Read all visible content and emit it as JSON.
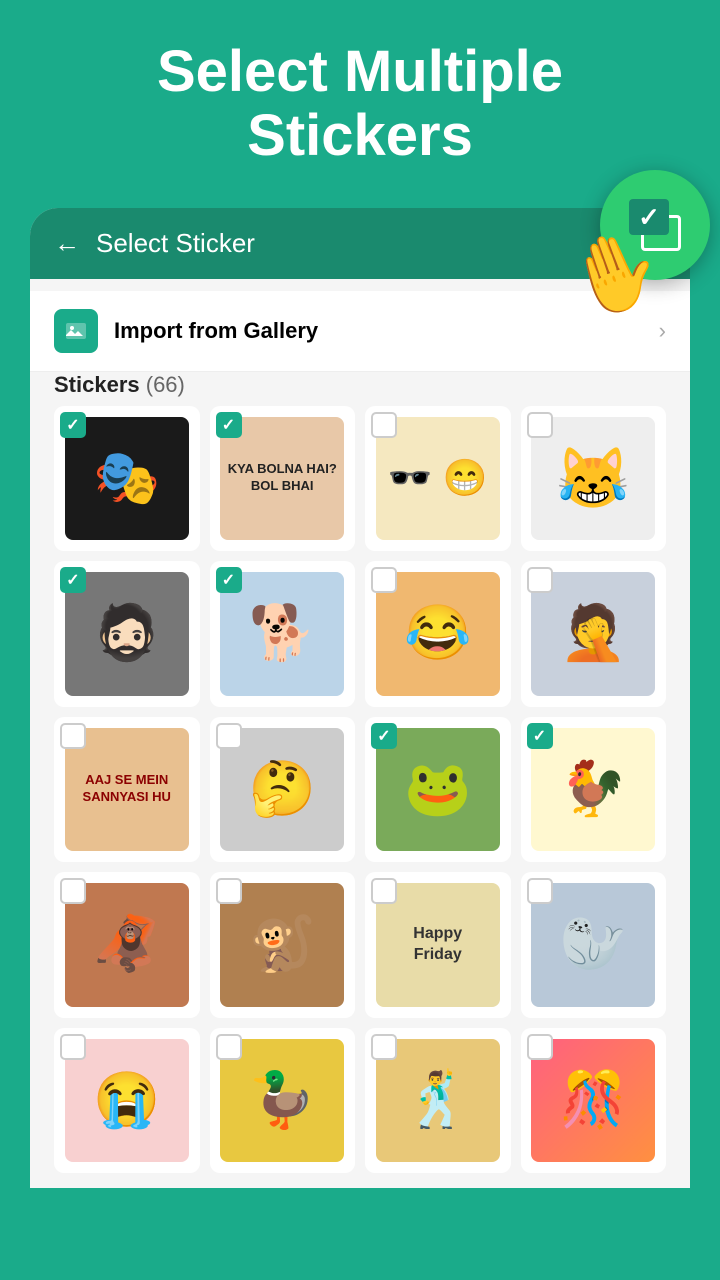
{
  "header": {
    "line1": "Select Multiple",
    "line2": "Stickers"
  },
  "topbar": {
    "title": "Select Sticker",
    "back_label": "←"
  },
  "import": {
    "label": "Import from Gallery",
    "chevron": "›"
  },
  "stickers_section": {
    "label": "Stickers",
    "count": "(66)"
  },
  "fab": {
    "label": "multi-select"
  },
  "stickers": [
    {
      "id": 1,
      "checked": true,
      "emoji": "🎭",
      "bg": "#1a1a1a"
    },
    {
      "id": 2,
      "checked": true,
      "text": "KYA BOLNA HAI? BOL BHAI",
      "bg": "#e8d5c4"
    },
    {
      "id": 3,
      "checked": false,
      "emoji": "🕶️😁",
      "bg": "#f9e4b7"
    },
    {
      "id": 4,
      "checked": false,
      "emoji": "😹",
      "bg": "#eee"
    },
    {
      "id": 5,
      "checked": true,
      "emoji": "🧔",
      "bg": "#555"
    },
    {
      "id": 6,
      "checked": true,
      "emoji": "🐕",
      "bg": "#c9d8e8"
    },
    {
      "id": 7,
      "checked": false,
      "emoji": "😂",
      "bg": "#f0c070"
    },
    {
      "id": 8,
      "checked": false,
      "emoji": "🤦",
      "bg": "#d0d8e0"
    },
    {
      "id": 9,
      "checked": false,
      "text": "AAJ SE MEIN SANNYASI HU",
      "bg": "#e8c4a0"
    },
    {
      "id": 10,
      "checked": false,
      "emoji": "🤔",
      "bg": "#d0d0d0"
    },
    {
      "id": 11,
      "checked": true,
      "emoji": "🐸",
      "bg": "#6aaa4a"
    },
    {
      "id": 12,
      "checked": true,
      "emoji": "🐓",
      "bg": "#fff8e0"
    },
    {
      "id": 13,
      "checked": false,
      "emoji": "🦧",
      "bg": "#c8845a"
    },
    {
      "id": 14,
      "checked": false,
      "emoji": "🐒",
      "bg": "#c09060"
    },
    {
      "id": 15,
      "checked": false,
      "text": "Happy Friday",
      "bg": "#f0e8c8"
    },
    {
      "id": 16,
      "checked": false,
      "emoji": "🦭",
      "bg": "#c8d8e8"
    },
    {
      "id": 17,
      "checked": false,
      "emoji": "😭",
      "bg": "#f8d8d8"
    },
    {
      "id": 18,
      "checked": false,
      "emoji": "🦆",
      "bg": "#e8d060"
    },
    {
      "id": 19,
      "checked": false,
      "emoji": "🕺",
      "bg": "#f0d898"
    },
    {
      "id": 20,
      "checked": false,
      "emoji": "🎊",
      "bg": "#ff6080"
    }
  ]
}
